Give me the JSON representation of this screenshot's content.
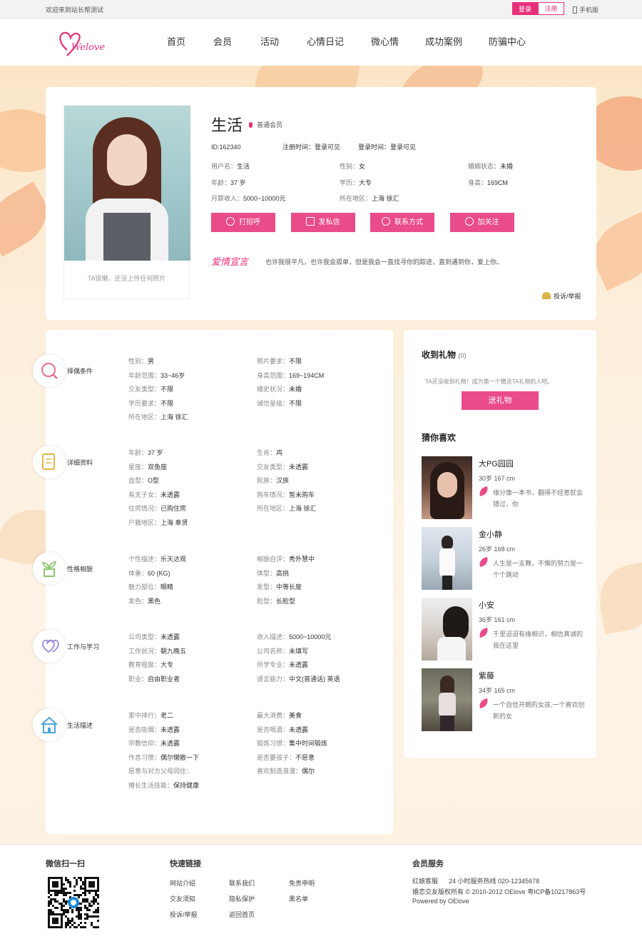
{
  "topbar": {
    "welcome": "欢迎来到站长帮测试",
    "login": "登录",
    "register": "注册",
    "mobile": "手机版"
  },
  "logo": {
    "text": "Welove"
  },
  "nav": [
    "首页",
    "会员",
    "活动",
    "心情日记",
    "微心情",
    "成功案例",
    "防骗中心"
  ],
  "profile": {
    "name": "生活",
    "level": "普通会员",
    "id_label": "ID:162340",
    "reg_time": "注册时间：登录可见",
    "login_time": "登录时间：登录可见",
    "photo_caption": "TA很懒，还没上传任何照片",
    "info": [
      {
        "k": "用户名：",
        "v": "生活"
      },
      {
        "k": "性别：",
        "v": "女"
      },
      {
        "k": "婚姻状态：",
        "v": "未婚"
      },
      {
        "k": "年龄：",
        "v": "37 岁"
      },
      {
        "k": "学历：",
        "v": "大专"
      },
      {
        "k": "身高：",
        "v": "169CM"
      },
      {
        "k": "月薪收入：",
        "v": "5000~10000元"
      },
      {
        "k": "所在地区：",
        "v": "上海 徐汇"
      }
    ],
    "actions": [
      "打招呼",
      "发私信",
      "联系方式",
      "加关注"
    ],
    "love_title": "爱情宣言",
    "love_text": "也许我很平凡，也许我会孤单，但是我会一直找寻你的踪迹，直到遇到你，爱上你。",
    "report": "投诉/举报"
  },
  "sections": [
    {
      "title": "择偶条件",
      "icon": "search-icon",
      "rows": [
        [
          {
            "k": "性别：",
            "v": "男"
          },
          {
            "k": "照片要求：",
            "v": "不限"
          }
        ],
        [
          {
            "k": "年龄范围：",
            "v": "33~46岁"
          },
          {
            "k": "身高范围：",
            "v": "169~194CM"
          }
        ],
        [
          {
            "k": "交友类型：",
            "v": "不限"
          },
          {
            "k": "婚史状况：",
            "v": "未婚"
          }
        ],
        [
          {
            "k": "学历要求：",
            "v": "不限"
          },
          {
            "k": "诚信星级：",
            "v": "不限"
          }
        ],
        [
          {
            "k": "所在地区：",
            "v": "上海 徐汇"
          }
        ]
      ]
    },
    {
      "title": "详细资料",
      "icon": "document-icon",
      "rows": [
        [
          {
            "k": "年龄：",
            "v": "37 岁"
          },
          {
            "k": "生肖：",
            "v": "鸡"
          }
        ],
        [
          {
            "k": "星座：",
            "v": "双鱼座"
          },
          {
            "k": "交友类型：",
            "v": "未透露"
          }
        ],
        [
          {
            "k": "血型：",
            "v": "O型"
          },
          {
            "k": "民族：",
            "v": "汉族"
          }
        ],
        [
          {
            "k": "有无子女：",
            "v": "未透露"
          },
          {
            "k": "购车情况：",
            "v": "暂未购车"
          }
        ],
        [
          {
            "k": "住房情况：",
            "v": "已购住房"
          },
          {
            "k": "所在地区：",
            "v": "上海 徐汇"
          }
        ],
        [
          {
            "k": "户籍地区：",
            "v": "上海 奉贤"
          }
        ]
      ]
    },
    {
      "title": "性格相貌",
      "icon": "plant-icon",
      "rows": [
        [
          {
            "k": "个性描述：",
            "v": "乐天达观"
          },
          {
            "k": "相貌自评：",
            "v": "秀外慧中"
          }
        ],
        [
          {
            "k": "体重：",
            "v": "60 (KG)"
          },
          {
            "k": "体型：",
            "v": "高挑"
          }
        ],
        [
          {
            "k": "魅力部位：",
            "v": "眼睛"
          },
          {
            "k": "发型：",
            "v": "中等长度"
          }
        ],
        [
          {
            "k": "发色：",
            "v": "黑色"
          },
          {
            "k": "脸型：",
            "v": "长脸型"
          }
        ]
      ]
    },
    {
      "title": "工作与学习",
      "icon": "hearts-icon",
      "rows": [
        [
          {
            "k": "公司类型：",
            "v": "未透露"
          },
          {
            "k": "收入描述：",
            "v": "5000~10000元"
          }
        ],
        [
          {
            "k": "工作状况：",
            "v": "朝九晚五"
          },
          {
            "k": "公司名称：",
            "v": "未填写"
          }
        ],
        [
          {
            "k": "教育程度：",
            "v": "大专"
          },
          {
            "k": "所学专业：",
            "v": "未透露"
          }
        ],
        [
          {
            "k": "职业：",
            "v": "自由职业者"
          },
          {
            "k": "语言能力：",
            "v": "中文(普通话)  英语"
          }
        ]
      ]
    },
    {
      "title": "生活描述",
      "icon": "house-icon",
      "rows": [
        [
          {
            "k": "家中排行：",
            "v": "老二"
          },
          {
            "k": "最大消费：",
            "v": "美食"
          }
        ],
        [
          {
            "k": "是否吸烟：",
            "v": "未透露"
          },
          {
            "k": "是否喝酒：",
            "v": "未透露"
          }
        ],
        [
          {
            "k": "宗教信仰：",
            "v": "未透露"
          },
          {
            "k": "锻炼习惯：",
            "v": "集中时间锻炼"
          }
        ],
        [
          {
            "k": "作息习惯：",
            "v": "偶尔懒散一下"
          },
          {
            "k": "是否要孩子：",
            "v": "不愿意"
          }
        ],
        [
          {
            "k": "愿意与对方父母同住：",
            "v": ""
          },
          {
            "k": "喜欢制造浪漫：",
            "v": "偶尔"
          }
        ],
        [
          {
            "k": "擅长生活技能：",
            "v": "保持健康"
          }
        ]
      ]
    }
  ],
  "gift": {
    "title": "收到礼物",
    "count": "(0)",
    "hint": "TA还没收到礼物！成为第一个赠送TA礼物的人吧。",
    "button": "送礼物"
  },
  "guess": {
    "title": "猜你喜欢",
    "items": [
      {
        "name": "大PG园园",
        "meta": "30岁 167 cm",
        "quote": "缘分像一本书，翻得不经意就会错过，你"
      },
      {
        "name": "金小静",
        "meta": "26岁 168 cm",
        "quote": "人生是一支舞，不懈的努力是一个个跳动"
      },
      {
        "name": "小安",
        "meta": "36岁 161 cm",
        "quote": "千里迢迢有缘相识，相信真诚的我在这里"
      },
      {
        "name": "紫藤",
        "meta": "34岁 165 cm",
        "quote": "一个自信开朗的女孩,一个喜欢创新的女"
      }
    ]
  },
  "footer": {
    "wechat_title": "微信扫一扫",
    "links_title": "快速链接",
    "links": [
      "网站介绍",
      "联系我们",
      "免责申明",
      "交友须知",
      "隐私保护",
      "黑名单",
      "投诉/举报",
      "返回首页"
    ],
    "service_title": "会员服务",
    "service_line1_a": "红娘客服",
    "service_line1_b": "24 小时服务热线 020-12345678",
    "service_line2": "婚恋交友版权所有 © 2010-2012 OElove   粤ICP备10217863号",
    "service_line3": "Powered by OElove"
  },
  "colors": {
    "accent": "#ea4b89",
    "brand": "#e8307a"
  }
}
